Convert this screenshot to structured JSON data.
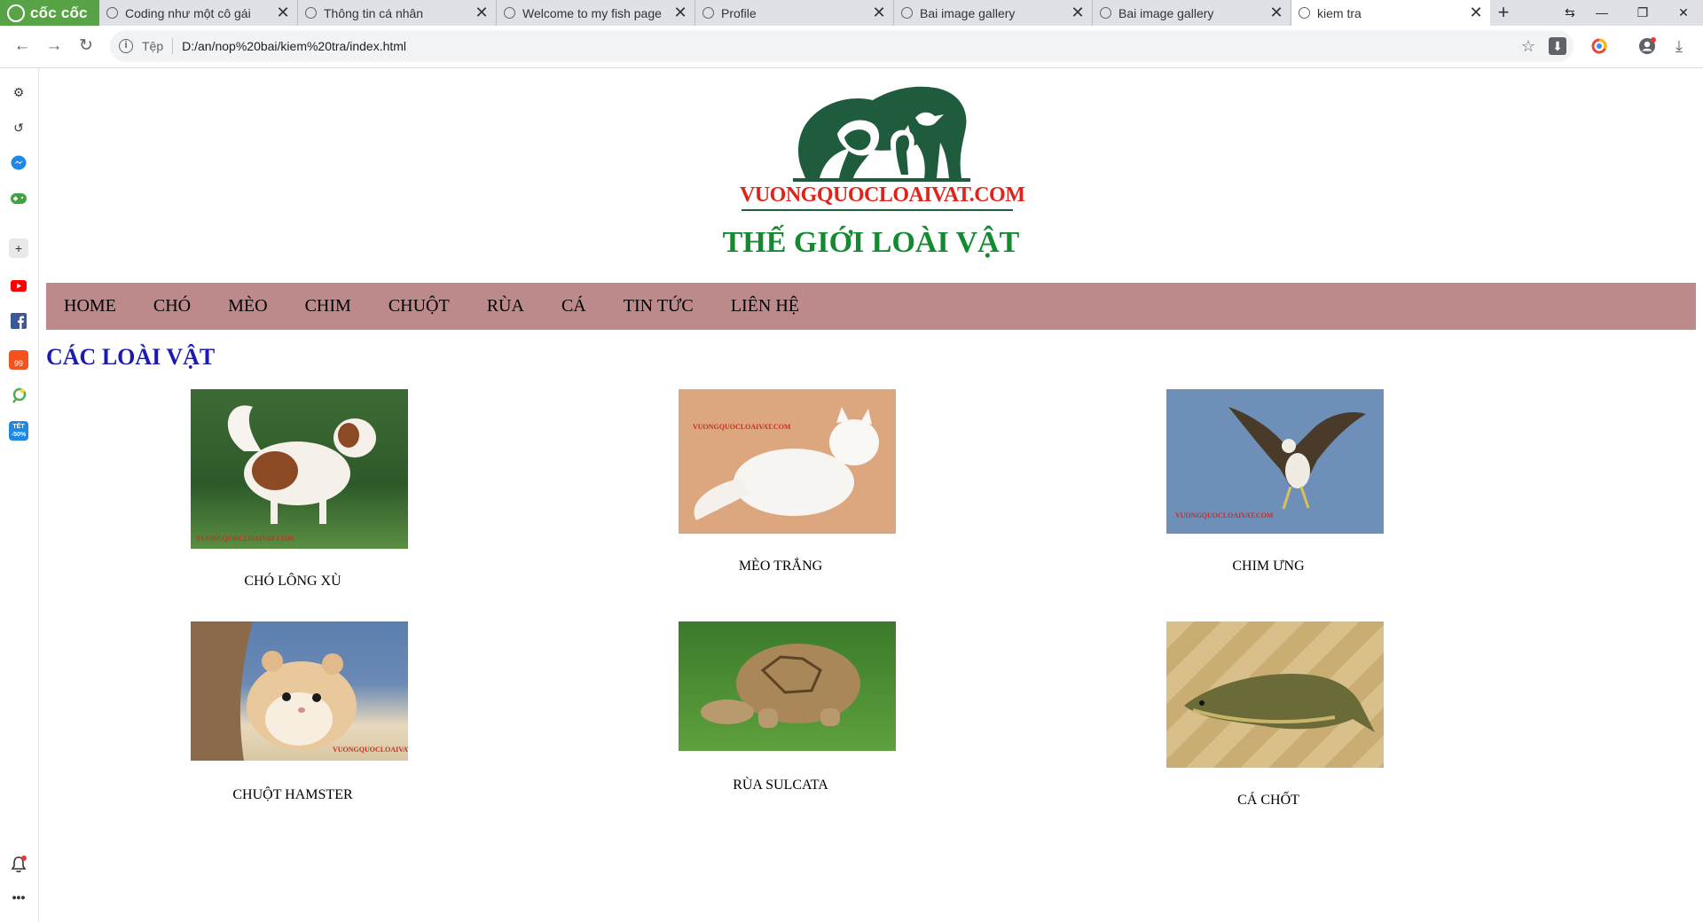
{
  "browser": {
    "logo_text": "cốc cốc",
    "tabs": [
      {
        "title": "Coding như một cô gái",
        "active": false
      },
      {
        "title": "Thông tin cá nhân",
        "active": false
      },
      {
        "title": "Welcome to my fish page",
        "active": false
      },
      {
        "title": "Profile",
        "active": false
      },
      {
        "title": "Bai image gallery",
        "active": false
      },
      {
        "title": "Bai image gallery",
        "active": false
      },
      {
        "title": "kiem tra",
        "active": true
      }
    ],
    "address": {
      "scheme_label": "Tệp",
      "url": "D:/an/nop%20bai/kiem%20tra/index.html"
    }
  },
  "sidebar": {
    "items": [
      "settings-icon",
      "history-icon",
      "messenger-icon",
      "game-icon",
      "add-icon",
      "youtube-icon",
      "facebook-icon",
      "shopping-icon",
      "extension-icon",
      "discount-icon",
      "notification-icon",
      "more-icon"
    ],
    "discount_badge": "TẾT -50%",
    "shopping_badge": "99"
  },
  "page": {
    "logo_text": "VUONGQUOCLOAIVAT.COM",
    "watermark": "VUONGQUOCLOAIVAT.COM",
    "title": "THẾ GIỚI LOÀI VẬT",
    "nav": [
      "HOME",
      "CHÓ",
      "MÈO",
      "CHIM",
      "CHUỘT",
      "RÙA",
      "CÁ",
      "TIN TỨC",
      "LIÊN HỆ"
    ],
    "section_title": "CÁC LOÀI VẬT",
    "animals": [
      {
        "caption": "CHÓ LÔNG XÙ",
        "image": "dog-photo"
      },
      {
        "caption": "MÈO TRẮNG",
        "image": "cat-photo"
      },
      {
        "caption": "CHIM ƯNG",
        "image": "eagle-photo"
      },
      {
        "caption": "CHUỘT HAMSTER",
        "image": "hamster-photo"
      },
      {
        "caption": "RÙA SULCATA",
        "image": "tortoise-photo"
      },
      {
        "caption": "CÁ CHỐT",
        "image": "fish-photo"
      }
    ]
  },
  "colors": {
    "nav_bg": "#bc8a8a",
    "title_green": "#128a2f",
    "section_blue": "#1b1bb0",
    "logo_red": "#e2231a",
    "logo_green": "#1f5c3d"
  }
}
